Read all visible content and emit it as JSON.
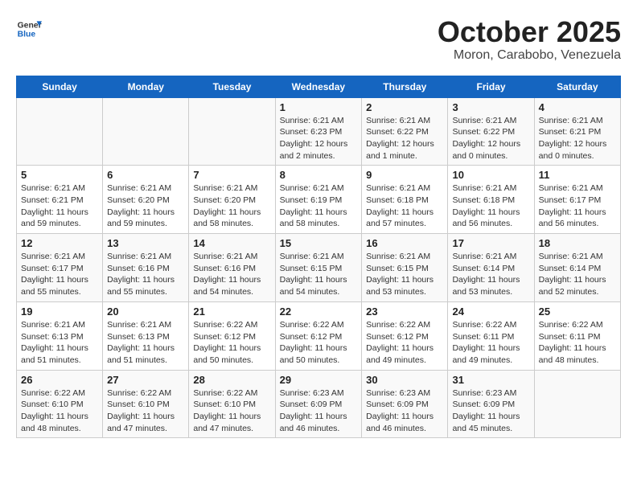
{
  "header": {
    "logo_general": "General",
    "logo_blue": "Blue",
    "month": "October 2025",
    "location": "Moron, Carabobo, Venezuela"
  },
  "weekdays": [
    "Sunday",
    "Monday",
    "Tuesday",
    "Wednesday",
    "Thursday",
    "Friday",
    "Saturday"
  ],
  "weeks": [
    [
      {
        "day": "",
        "info": ""
      },
      {
        "day": "",
        "info": ""
      },
      {
        "day": "",
        "info": ""
      },
      {
        "day": "1",
        "info": "Sunrise: 6:21 AM\nSunset: 6:23 PM\nDaylight: 12 hours and 2 minutes."
      },
      {
        "day": "2",
        "info": "Sunrise: 6:21 AM\nSunset: 6:22 PM\nDaylight: 12 hours and 1 minute."
      },
      {
        "day": "3",
        "info": "Sunrise: 6:21 AM\nSunset: 6:22 PM\nDaylight: 12 hours and 0 minutes."
      },
      {
        "day": "4",
        "info": "Sunrise: 6:21 AM\nSunset: 6:21 PM\nDaylight: 12 hours and 0 minutes."
      }
    ],
    [
      {
        "day": "5",
        "info": "Sunrise: 6:21 AM\nSunset: 6:21 PM\nDaylight: 11 hours and 59 minutes."
      },
      {
        "day": "6",
        "info": "Sunrise: 6:21 AM\nSunset: 6:20 PM\nDaylight: 11 hours and 59 minutes."
      },
      {
        "day": "7",
        "info": "Sunrise: 6:21 AM\nSunset: 6:20 PM\nDaylight: 11 hours and 58 minutes."
      },
      {
        "day": "8",
        "info": "Sunrise: 6:21 AM\nSunset: 6:19 PM\nDaylight: 11 hours and 58 minutes."
      },
      {
        "day": "9",
        "info": "Sunrise: 6:21 AM\nSunset: 6:18 PM\nDaylight: 11 hours and 57 minutes."
      },
      {
        "day": "10",
        "info": "Sunrise: 6:21 AM\nSunset: 6:18 PM\nDaylight: 11 hours and 56 minutes."
      },
      {
        "day": "11",
        "info": "Sunrise: 6:21 AM\nSunset: 6:17 PM\nDaylight: 11 hours and 56 minutes."
      }
    ],
    [
      {
        "day": "12",
        "info": "Sunrise: 6:21 AM\nSunset: 6:17 PM\nDaylight: 11 hours and 55 minutes."
      },
      {
        "day": "13",
        "info": "Sunrise: 6:21 AM\nSunset: 6:16 PM\nDaylight: 11 hours and 55 minutes."
      },
      {
        "day": "14",
        "info": "Sunrise: 6:21 AM\nSunset: 6:16 PM\nDaylight: 11 hours and 54 minutes."
      },
      {
        "day": "15",
        "info": "Sunrise: 6:21 AM\nSunset: 6:15 PM\nDaylight: 11 hours and 54 minutes."
      },
      {
        "day": "16",
        "info": "Sunrise: 6:21 AM\nSunset: 6:15 PM\nDaylight: 11 hours and 53 minutes."
      },
      {
        "day": "17",
        "info": "Sunrise: 6:21 AM\nSunset: 6:14 PM\nDaylight: 11 hours and 53 minutes."
      },
      {
        "day": "18",
        "info": "Sunrise: 6:21 AM\nSunset: 6:14 PM\nDaylight: 11 hours and 52 minutes."
      }
    ],
    [
      {
        "day": "19",
        "info": "Sunrise: 6:21 AM\nSunset: 6:13 PM\nDaylight: 11 hours and 51 minutes."
      },
      {
        "day": "20",
        "info": "Sunrise: 6:21 AM\nSunset: 6:13 PM\nDaylight: 11 hours and 51 minutes."
      },
      {
        "day": "21",
        "info": "Sunrise: 6:22 AM\nSunset: 6:12 PM\nDaylight: 11 hours and 50 minutes."
      },
      {
        "day": "22",
        "info": "Sunrise: 6:22 AM\nSunset: 6:12 PM\nDaylight: 11 hours and 50 minutes."
      },
      {
        "day": "23",
        "info": "Sunrise: 6:22 AM\nSunset: 6:12 PM\nDaylight: 11 hours and 49 minutes."
      },
      {
        "day": "24",
        "info": "Sunrise: 6:22 AM\nSunset: 6:11 PM\nDaylight: 11 hours and 49 minutes."
      },
      {
        "day": "25",
        "info": "Sunrise: 6:22 AM\nSunset: 6:11 PM\nDaylight: 11 hours and 48 minutes."
      }
    ],
    [
      {
        "day": "26",
        "info": "Sunrise: 6:22 AM\nSunset: 6:10 PM\nDaylight: 11 hours and 48 minutes."
      },
      {
        "day": "27",
        "info": "Sunrise: 6:22 AM\nSunset: 6:10 PM\nDaylight: 11 hours and 47 minutes."
      },
      {
        "day": "28",
        "info": "Sunrise: 6:22 AM\nSunset: 6:10 PM\nDaylight: 11 hours and 47 minutes."
      },
      {
        "day": "29",
        "info": "Sunrise: 6:23 AM\nSunset: 6:09 PM\nDaylight: 11 hours and 46 minutes."
      },
      {
        "day": "30",
        "info": "Sunrise: 6:23 AM\nSunset: 6:09 PM\nDaylight: 11 hours and 46 minutes."
      },
      {
        "day": "31",
        "info": "Sunrise: 6:23 AM\nSunset: 6:09 PM\nDaylight: 11 hours and 45 minutes."
      },
      {
        "day": "",
        "info": ""
      }
    ]
  ]
}
